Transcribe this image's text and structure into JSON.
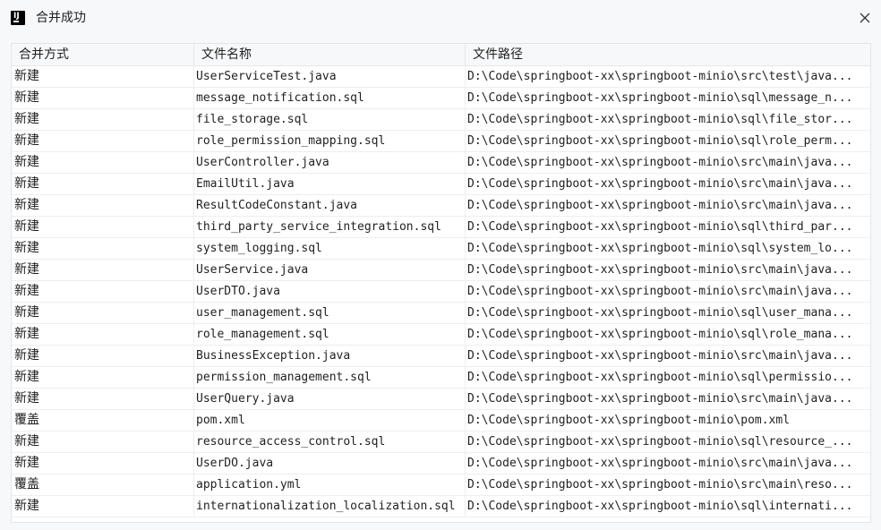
{
  "window": {
    "title": "合并成功",
    "icon": "jetbrains-icon"
  },
  "table": {
    "headers": [
      "合并方式",
      "文件名称",
      "文件路径"
    ],
    "rows": [
      [
        "新建",
        "UserServiceTest.java",
        "D:\\Code\\springboot-xx\\springboot-minio\\src\\test\\java..."
      ],
      [
        "新建",
        "message_notification.sql",
        "D:\\Code\\springboot-xx\\springboot-minio\\sql\\message_n..."
      ],
      [
        "新建",
        "file_storage.sql",
        "D:\\Code\\springboot-xx\\springboot-minio\\sql\\file_stor..."
      ],
      [
        "新建",
        "role_permission_mapping.sql",
        "D:\\Code\\springboot-xx\\springboot-minio\\sql\\role_perm..."
      ],
      [
        "新建",
        "UserController.java",
        "D:\\Code\\springboot-xx\\springboot-minio\\src\\main\\java..."
      ],
      [
        "新建",
        "EmailUtil.java",
        "D:\\Code\\springboot-xx\\springboot-minio\\src\\main\\java..."
      ],
      [
        "新建",
        "ResultCodeConstant.java",
        "D:\\Code\\springboot-xx\\springboot-minio\\src\\main\\java..."
      ],
      [
        "新建",
        "third_party_service_integration.sql",
        "D:\\Code\\springboot-xx\\springboot-minio\\sql\\third_par..."
      ],
      [
        "新建",
        "system_logging.sql",
        "D:\\Code\\springboot-xx\\springboot-minio\\sql\\system_lo..."
      ],
      [
        "新建",
        "UserService.java",
        "D:\\Code\\springboot-xx\\springboot-minio\\src\\main\\java..."
      ],
      [
        "新建",
        "UserDTO.java",
        "D:\\Code\\springboot-xx\\springboot-minio\\src\\main\\java..."
      ],
      [
        "新建",
        "user_management.sql",
        "D:\\Code\\springboot-xx\\springboot-minio\\sql\\user_mana..."
      ],
      [
        "新建",
        "role_management.sql",
        "D:\\Code\\springboot-xx\\springboot-minio\\sql\\role_mana..."
      ],
      [
        "新建",
        "BusinessException.java",
        "D:\\Code\\springboot-xx\\springboot-minio\\src\\main\\java..."
      ],
      [
        "新建",
        "permission_management.sql",
        "D:\\Code\\springboot-xx\\springboot-minio\\sql\\permissio..."
      ],
      [
        "新建",
        "UserQuery.java",
        "D:\\Code\\springboot-xx\\springboot-minio\\src\\main\\java..."
      ],
      [
        "覆盖",
        "pom.xml",
        "D:\\Code\\springboot-xx\\springboot-minio\\pom.xml"
      ],
      [
        "新建",
        "resource_access_control.sql",
        "D:\\Code\\springboot-xx\\springboot-minio\\sql\\resource_..."
      ],
      [
        "新建",
        "UserDO.java",
        "D:\\Code\\springboot-xx\\springboot-minio\\src\\main\\java..."
      ],
      [
        "覆盖",
        "application.yml",
        "D:\\Code\\springboot-xx\\springboot-minio\\src\\main\\reso..."
      ],
      [
        "新建",
        "internationalization_localization.sql",
        "D:\\Code\\springboot-xx\\springboot-minio\\sql\\internati..."
      ]
    ]
  }
}
